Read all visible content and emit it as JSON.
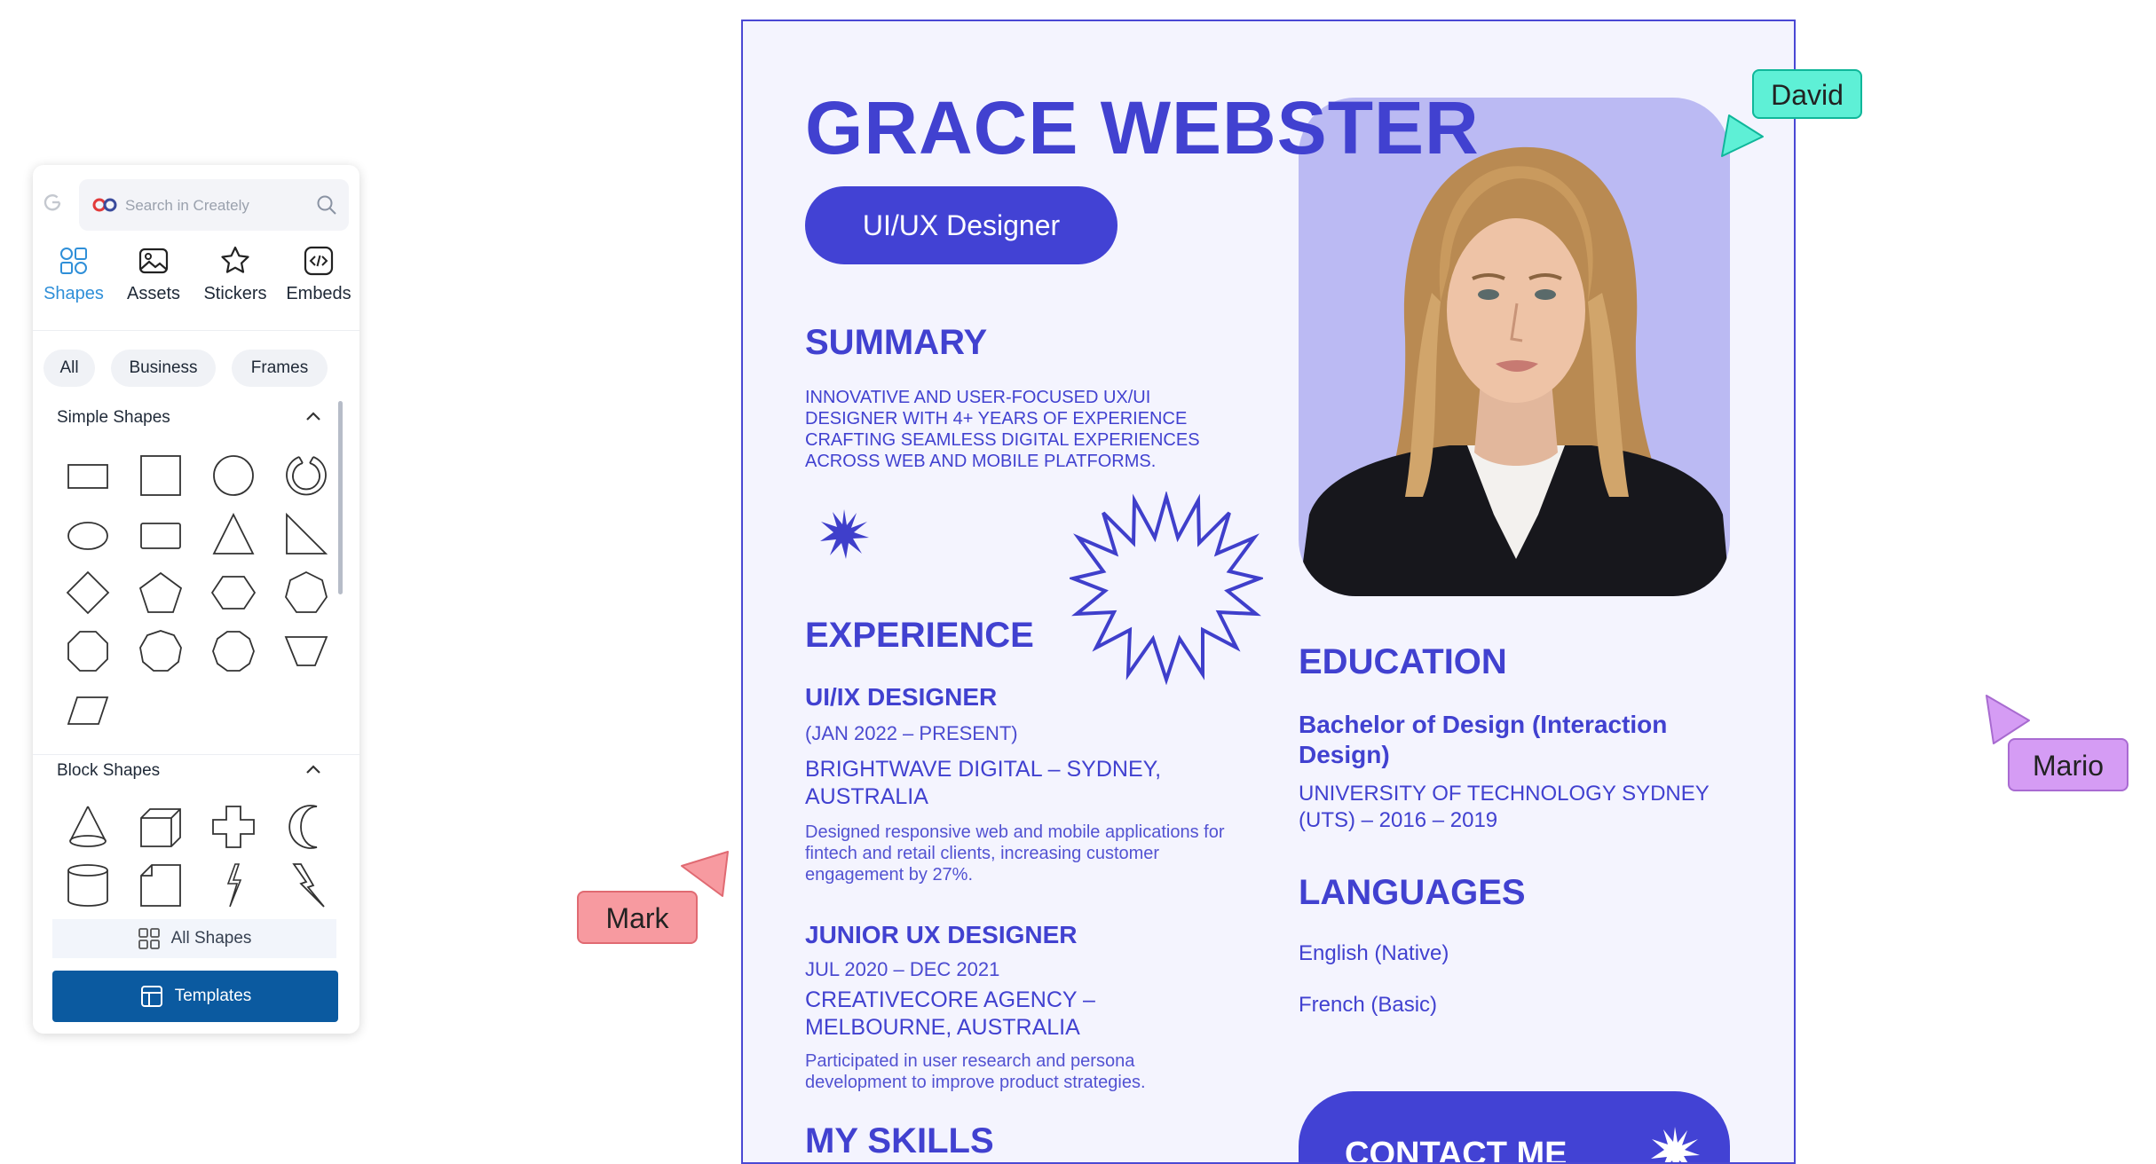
{
  "panel": {
    "search_placeholder": "Search in Creately",
    "tabs": [
      {
        "label": "Shapes",
        "icon": "shapes-icon",
        "active": true
      },
      {
        "label": "Assets",
        "icon": "image-icon"
      },
      {
        "label": "Stickers",
        "icon": "star-icon"
      },
      {
        "label": "Embeds",
        "icon": "code-icon"
      }
    ],
    "filters": [
      "All",
      "Business",
      "Frames"
    ],
    "sections": [
      {
        "title": "Simple Shapes",
        "shapes": [
          "rectangle",
          "square",
          "circle",
          "arc",
          "ellipse",
          "rounded-rectangle",
          "triangle",
          "right-triangle",
          "diamond",
          "pentagon",
          "hexagon",
          "heptagon",
          "octagon",
          "nonagon",
          "decagon",
          "inverted-trapezoid",
          "parallelogram"
        ]
      },
      {
        "title": "Block Shapes",
        "shapes": [
          "cone",
          "cube",
          "cross",
          "moon",
          "cylinder",
          "folded-corner",
          "lightning",
          "lightning-bold"
        ]
      }
    ],
    "all_shapes_label": "All Shapes",
    "templates_label": "Templates"
  },
  "resume": {
    "name": "GRACE WEBSTER",
    "role": "UI/UX Designer",
    "summary_title": "SUMMARY",
    "summary_text": "INNOVATIVE AND USER-FOCUSED UX/UI DESIGNER WITH 4+ YEARS OF EXPERIENCE CRAFTING SEAMLESS DIGITAL EXPERIENCES ACROSS WEB AND MOBILE PLATFORMS.",
    "experience_title": "EXPERIENCE",
    "jobs": [
      {
        "title": "UI/IX DESIGNER",
        "dates": "(JAN 2022 – PRESENT)",
        "company": "BRIGHTWAVE DIGITAL – SYDNEY, AUSTRALIA",
        "description": "Designed responsive web and mobile applications for fintech and retail clients, increasing customer engagement by 27%."
      },
      {
        "title": "JUNIOR UX DESIGNER",
        "dates": "JUL 2020 – DEC 2021",
        "company": "CREATIVECORE AGENCY – MELBOURNE, AUSTRALIA",
        "description": "Participated in user research and persona development to improve product strategies."
      }
    ],
    "skills_title": "MY SKILLS",
    "education_title": "EDUCATION",
    "degree": "Bachelor of Design (Interaction Design)",
    "university": "UNIVERSITY OF TECHNOLOGY SYDNEY (UTS) – 2016 – 2019",
    "languages_title": "LANGUAGES",
    "languages": [
      "English (Native)",
      "French (Basic)"
    ],
    "contact_label": "CONTACT ME"
  },
  "collaborators": [
    {
      "name": "David",
      "color": "#5ef0d6"
    },
    {
      "name": "Mario",
      "color": "#d59cf4"
    },
    {
      "name": "Mark",
      "color": "#f79aa0"
    }
  ],
  "colors": {
    "resume_accent": "#4242d4",
    "resume_background": "#f4f4fe",
    "photo_background": "#bbbaf3",
    "templates_button": "#0b5aa0",
    "active_tab": "#2f8fd8"
  }
}
